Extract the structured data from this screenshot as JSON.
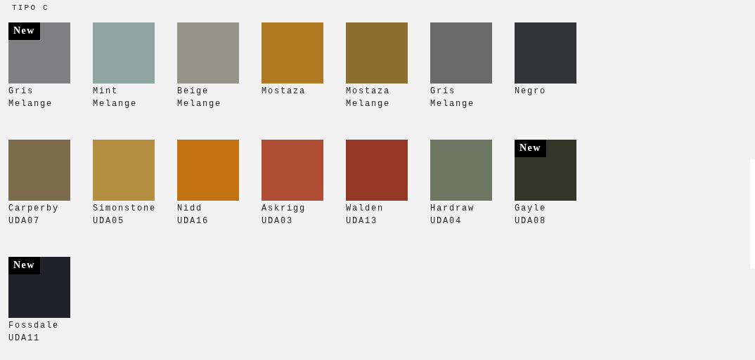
{
  "section_title": "TIPO C",
  "swatches": [
    {
      "name": "Gris Melange",
      "color": "#7f7f82",
      "badge": "New"
    },
    {
      "name": "Mint Melange",
      "color": "#8ea69f"
    },
    {
      "name": "Beige Melange",
      "color": "#96958a"
    },
    {
      "name": "Mostaza",
      "color": "#b07a22"
    },
    {
      "name": "Mostaza Melange",
      "color": "#8c6e2e"
    },
    {
      "name": "Gris Melange",
      "color": "#69696a"
    },
    {
      "name": "Negro",
      "color": "#333438"
    },
    {
      "name": "Carperby",
      "code": "UDA07",
      "color": "#7c6c4c"
    },
    {
      "name": "Simonstone",
      "code": "UDA05",
      "color": "#b48f42"
    },
    {
      "name": "Nidd",
      "code": "UDA16",
      "color": "#c27210"
    },
    {
      "name": "Askrigg",
      "code": "UDA03",
      "color": "#b04e35"
    },
    {
      "name": "Walden",
      "code": "UDA13",
      "color": "#953725"
    },
    {
      "name": "Hardraw",
      "code": "UDA04",
      "color": "#6c7660"
    },
    {
      "name": "Gayle",
      "code": "UDA08",
      "color": "#333626",
      "badge": "New"
    },
    {
      "name": "Fossdale",
      "code": "UDA11",
      "color": "#20212a",
      "badge": "New"
    }
  ]
}
